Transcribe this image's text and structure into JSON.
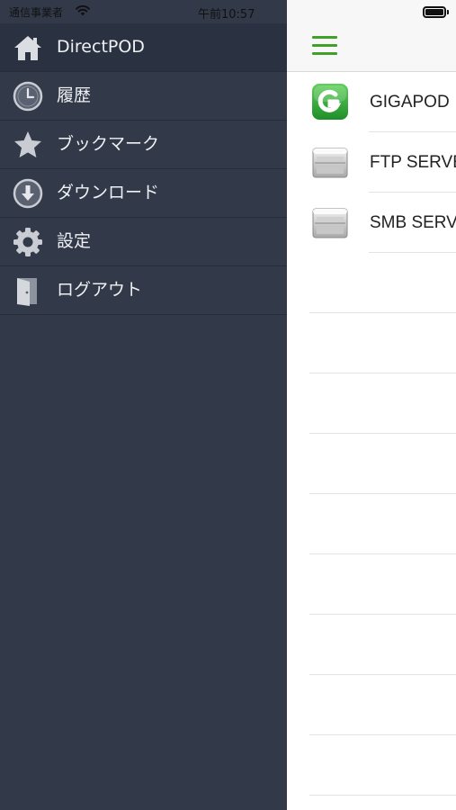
{
  "status_bar": {
    "carrier": "通信事業者",
    "time": "午前10:57"
  },
  "sidebar": {
    "items": [
      {
        "label": "DirectPOD",
        "icon": "home-icon",
        "active": true
      },
      {
        "label": "履歴",
        "icon": "clock-icon"
      },
      {
        "label": "ブックマーク",
        "icon": "star-icon"
      },
      {
        "label": "ダウンロード",
        "icon": "download-icon"
      },
      {
        "label": "設定",
        "icon": "gear-icon"
      },
      {
        "label": "ログアウト",
        "icon": "door-icon"
      }
    ]
  },
  "main": {
    "menu_icon": "hamburger-menu-icon",
    "servers": [
      {
        "label": "GIGAPOD",
        "icon": "gigapod-logo-icon"
      },
      {
        "label": "FTP SERVER",
        "icon": "server-icon"
      },
      {
        "label": "SMB SERVER",
        "icon": "server-icon"
      }
    ]
  },
  "colors": {
    "sidebar_bg": "#323a4a",
    "accent_green": "#3fa12a"
  }
}
